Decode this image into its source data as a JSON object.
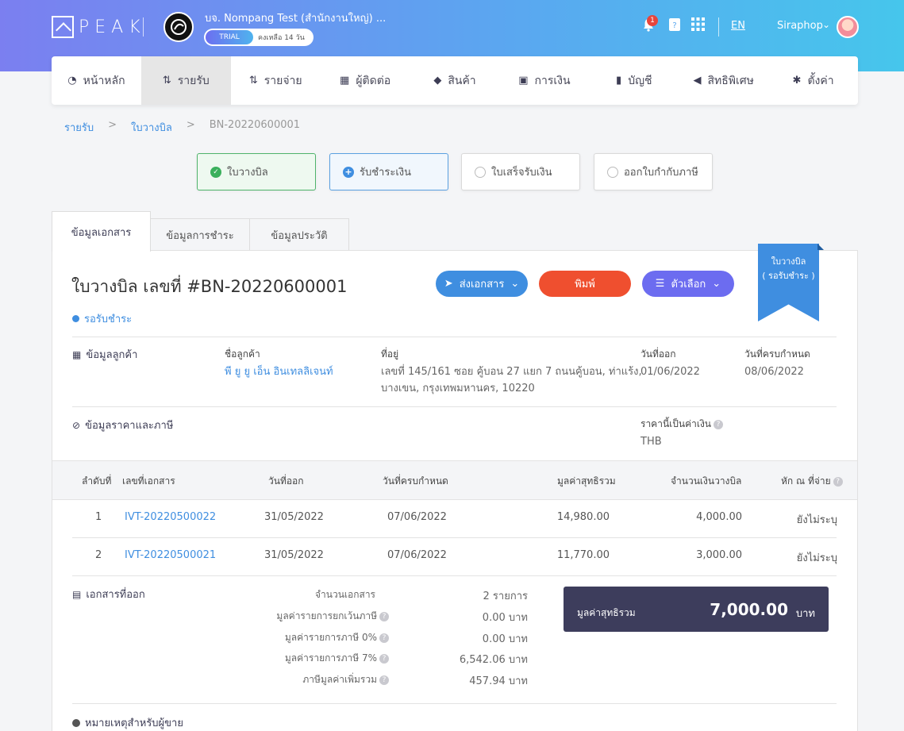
{
  "header": {
    "logo_text": "PEAK",
    "company_name": "บจ. Nompang Test (สำนักงานใหญ่) ...",
    "trial_label": "TRIAL",
    "trial_days": "คงเหลือ 14 วัน",
    "notification_count": "1",
    "language": "EN",
    "user_name": "Siraphop"
  },
  "nav": {
    "items": [
      {
        "label": "หน้าหลัก",
        "icon": "dashboard-icon"
      },
      {
        "label": "รายรับ",
        "icon": "income-icon"
      },
      {
        "label": "รายจ่าย",
        "icon": "expense-icon"
      },
      {
        "label": "ผู้ติดต่อ",
        "icon": "contacts-icon"
      },
      {
        "label": "สินค้า",
        "icon": "product-icon"
      },
      {
        "label": "การเงิน",
        "icon": "money-icon"
      },
      {
        "label": "บัญชี",
        "icon": "accounting-icon"
      },
      {
        "label": "สิทธิพิเศษ",
        "icon": "megaphone-icon"
      },
      {
        "label": "ตั้งค่า",
        "icon": "gear-icon"
      }
    ],
    "active_index": 1
  },
  "breadcrumb": {
    "items": [
      "รายรับ",
      "ใบวางบิล",
      "BN-20220600001"
    ],
    "separator": ">"
  },
  "steps": [
    {
      "label": "ใบวางบิล",
      "state": "done"
    },
    {
      "label": "รับชำระเงิน",
      "state": "current"
    },
    {
      "label": "ใบเสร็จรับเงิน",
      "state": "todo"
    },
    {
      "label": "ออกใบกำกับภาษี",
      "state": "todo"
    }
  ],
  "tabs": [
    "ข้อมูลเอกสาร",
    "ข้อมูลการชำระ",
    "ข้อมูลประวัติ"
  ],
  "document": {
    "title": "ใบวางบิล เลขที่ #BN-20220600001",
    "status": "รอรับชำระ",
    "ribbon_line1": "ใบวางบิล",
    "ribbon_line2": "( รอรับชำระ )",
    "buttons": {
      "send": "ส่งเอกสาร",
      "print": "พิมพ์",
      "options": "ตัวเลือก"
    }
  },
  "customer": {
    "section_label": "ข้อมูลลูกค้า",
    "name_label": "ชื่อลูกค้า",
    "name": "พี ยู ยู เอ็น อินเทลลิเจนท์",
    "address_label": "ที่อยู่",
    "address_line1": "เลขที่ 145/161 ซอย คู้บอน 27 แยก 7 ถนนคู้บอน, ท่าแร้ง,",
    "address_line2": "บางเขน, กรุงเทพมหานคร, 10220",
    "issue_date_label": "วันที่ออก",
    "issue_date": "01/06/2022",
    "due_date_label": "วันที่ครบกำหนด",
    "due_date": "08/06/2022"
  },
  "pricing": {
    "section_label": "ข้อมูลราคาและภาษี",
    "currency_label": "ราคานี้เป็นค่าเงิน",
    "currency": "THB"
  },
  "table": {
    "headers": [
      "ลำดับที่",
      "เลขที่เอกสาร",
      "วันที่ออก",
      "วันที่ครบกำหนด",
      "มูลค่าสุทธิรวม",
      "จำนวนเงินวางบิล",
      "หัก ณ ที่จ่าย"
    ],
    "rows": [
      {
        "no": "1",
        "doc_no": "IVT-20220500022",
        "issue": "31/05/2022",
        "due": "07/06/2022",
        "net": "14,980.00",
        "billed": "4,000.00",
        "wht": "ยังไม่ระบุ"
      },
      {
        "no": "2",
        "doc_no": "IVT-20220500021",
        "issue": "31/05/2022",
        "due": "07/06/2022",
        "net": "11,770.00",
        "billed": "3,000.00",
        "wht": "ยังไม่ระบุ"
      }
    ]
  },
  "summary": {
    "section_label": "เอกสารที่ออก",
    "lines": [
      {
        "label": "จำนวนเอกสาร",
        "value": "2 รายการ",
        "help": false
      },
      {
        "label": "มูลค่ารายการยกเว้นภาษี",
        "value": "0.00 บาท",
        "help": true
      },
      {
        "label": "มูลค่ารายการภาษี 0%",
        "value": "0.00 บาท",
        "help": true
      },
      {
        "label": "มูลค่ารายการภาษี 7%",
        "value": "6,542.06 บาท",
        "help": true
      },
      {
        "label": "ภาษีมูลค่าเพิ่มรวม",
        "value": "457.94 บาท",
        "help": true
      }
    ],
    "total_label": "มูลค่าสุทธิรวม",
    "total_value": "7,000.00",
    "total_unit": "บาท"
  },
  "notes": {
    "section_label": "หมายเหตุสำหรับผู้ขาย"
  }
}
